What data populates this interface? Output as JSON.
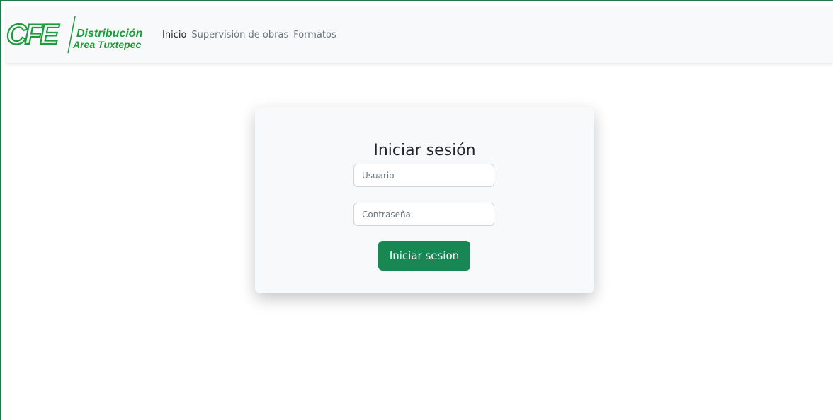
{
  "brand": {
    "logo_text": "CFE",
    "line1": "Distribución",
    "line2": "Area Tuxtepec",
    "color": "#1e9b3c"
  },
  "nav": {
    "items": [
      {
        "label": "Inicio",
        "active": true
      },
      {
        "label": "Supervisión de obras",
        "active": false
      },
      {
        "label": "Formatos",
        "active": false
      }
    ]
  },
  "login": {
    "title": "Iniciar sesión",
    "username_placeholder": "Usuario",
    "password_placeholder": "Contraseña",
    "submit_label": "Iniciar sesion",
    "button_color": "#198754"
  },
  "colors": {
    "frame_border": "#1e7a4a",
    "navbar_bg": "#f8f9fa"
  }
}
